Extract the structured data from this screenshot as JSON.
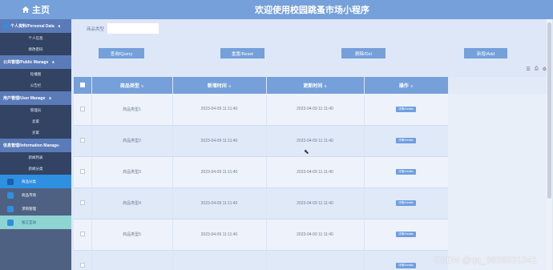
{
  "sidebar": {
    "home_label": "主页",
    "groups": [
      {
        "label": "个人资料/Personal Data",
        "subs": [
          "个人信息",
          "修改密码"
        ]
      },
      {
        "label": "公共管理/Public Manage",
        "subs": [
          "轮播图",
          "公告栏"
        ]
      },
      {
        "label": "用户管理/User Manage",
        "subs": [
          "管理员",
          "卖家",
          "买家"
        ]
      },
      {
        "label": "信息管理/Information Manage-",
        "subs": [
          "新闻列表",
          "新闻分类"
        ]
      }
    ],
    "items": [
      "商品分类",
      "商品市场",
      "求购管理",
      "留言互动"
    ]
  },
  "header": {
    "title": "欢迎使用校园跳蚤市场小程序"
  },
  "search": {
    "label": "商品类型",
    "value": ""
  },
  "buttons": {
    "query": "查询/Query",
    "reset": "重置/Reset",
    "delete": "删除/Del",
    "add": "新增/Add"
  },
  "table": {
    "columns": [
      "商品类型",
      "新增时间",
      "更新时间",
      "操作"
    ],
    "rows": [
      {
        "type": "商品类型1",
        "created": "2023-04-09 11:11:40",
        "updated": "2023-04-09 11:11:40",
        "action": "详情/Details"
      },
      {
        "type": "商品类型2",
        "created": "2023-04-09 11:11:40",
        "updated": "2023-04-09 11:11:40",
        "action": "详情/Details"
      },
      {
        "type": "商品类型3",
        "created": "2023-04-09 11:11:40",
        "updated": "2023-04-09 11:11:40",
        "action": "详情/Details"
      },
      {
        "type": "商品类型4",
        "created": "2023-04-09 11:11:40",
        "updated": "2023-04-09 11:11:40",
        "action": "详情/Details"
      },
      {
        "type": "商品类型5",
        "created": "2023-04-09 11:11:40",
        "updated": "2023-04-09 11:11:40",
        "action": "详情/Details"
      },
      {
        "type": "",
        "created": "",
        "updated": "",
        "action": "详情/Details"
      }
    ]
  },
  "tool_icons": [
    "list-icon",
    "print-icon",
    "settings-icon"
  ],
  "watermark": "CSDN @qq_3838531041",
  "colors": {
    "accent": "#75a0d9",
    "sidebar": "#4f6182",
    "active": "#2f8fe0"
  }
}
